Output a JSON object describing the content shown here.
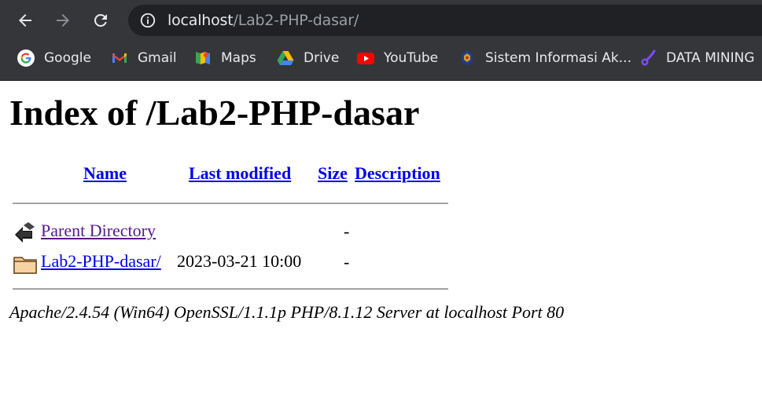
{
  "browser": {
    "url_host": "localhost",
    "url_path": "/Lab2-PHP-dasar/",
    "bookmarks": [
      {
        "label": "Google",
        "icon": "google-icon"
      },
      {
        "label": "Gmail",
        "icon": "gmail-icon"
      },
      {
        "label": "Maps",
        "icon": "maps-icon"
      },
      {
        "label": "Drive",
        "icon": "drive-icon"
      },
      {
        "label": "YouTube",
        "icon": "youtube-icon"
      },
      {
        "label": "Sistem Informasi Ak...",
        "icon": "university-icon"
      },
      {
        "label": "DATA MINING",
        "icon": "data-mining-icon"
      }
    ]
  },
  "page": {
    "title": "Index of /Lab2-PHP-dasar",
    "headers": {
      "name": "Name",
      "last_modified": "Last modified",
      "size": "Size",
      "description": "Description"
    },
    "rows": [
      {
        "name": "Parent Directory",
        "last_modified": "",
        "size": "-",
        "icon": "back-arrow-icon"
      },
      {
        "name": "Lab2-PHP-dasar/",
        "last_modified": "2023-03-21 10:00",
        "size": "-",
        "icon": "folder-icon"
      }
    ],
    "address": "Apache/2.4.54 (Win64) OpenSSL/1.1.1p PHP/8.1.12 Server at localhost Port 80"
  }
}
